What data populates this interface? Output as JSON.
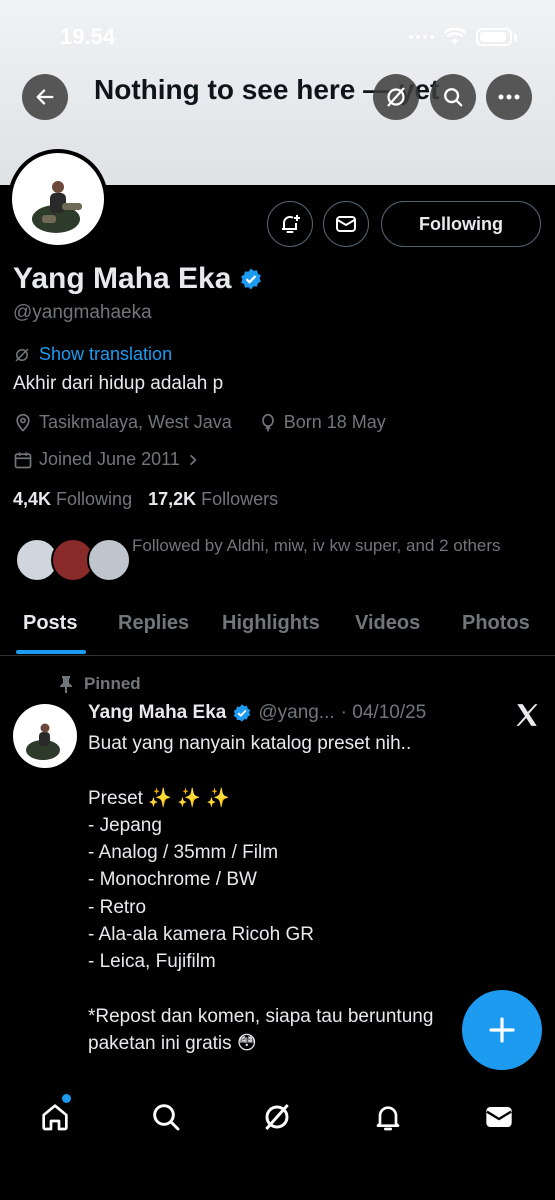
{
  "status": {
    "time": "19.54"
  },
  "header": {
    "title": "Nothing to see here — yet"
  },
  "profile": {
    "name": "Yang Maha Eka",
    "handle": "@yangmahaeka",
    "translate_label": "Show translation",
    "bio": "Akhir dari hidup adalah p",
    "location": "Tasikmalaya, West Java",
    "born": "Born 18 May",
    "joined": "Joined June 2011",
    "following_count": "4,4K",
    "following_label": "Following",
    "followers_count": "17,2K",
    "followers_label": "Followers",
    "followed_by": "Followed by Aldhi, miw, iv kw super, and 2 others",
    "follow_button": "Following"
  },
  "tabs": [
    {
      "label": "Posts"
    },
    {
      "label": "Replies"
    },
    {
      "label": "Highlights"
    },
    {
      "label": "Videos"
    },
    {
      "label": "Photos"
    }
  ],
  "post": {
    "pinned_label": "Pinned",
    "name": "Yang Maha Eka",
    "handle": "@yang...",
    "date": "· 04/10/25",
    "body": "Buat yang nanyain katalog preset nih..\n\nPreset ✨ ✨ ✨\n- Jepang\n- Analog / 35mm / Film\n- Monochrome / BW\n- Retro\n- Ala-ala kamera Ricoh GR\n- Leica, Fujifilm\n\n*Repost dan komen, siapa tau beruntung\npaketan ini gratis 😳"
  },
  "colors": {
    "accent": "#1d9bf0",
    "background": "#000000",
    "muted": "#71767b"
  }
}
